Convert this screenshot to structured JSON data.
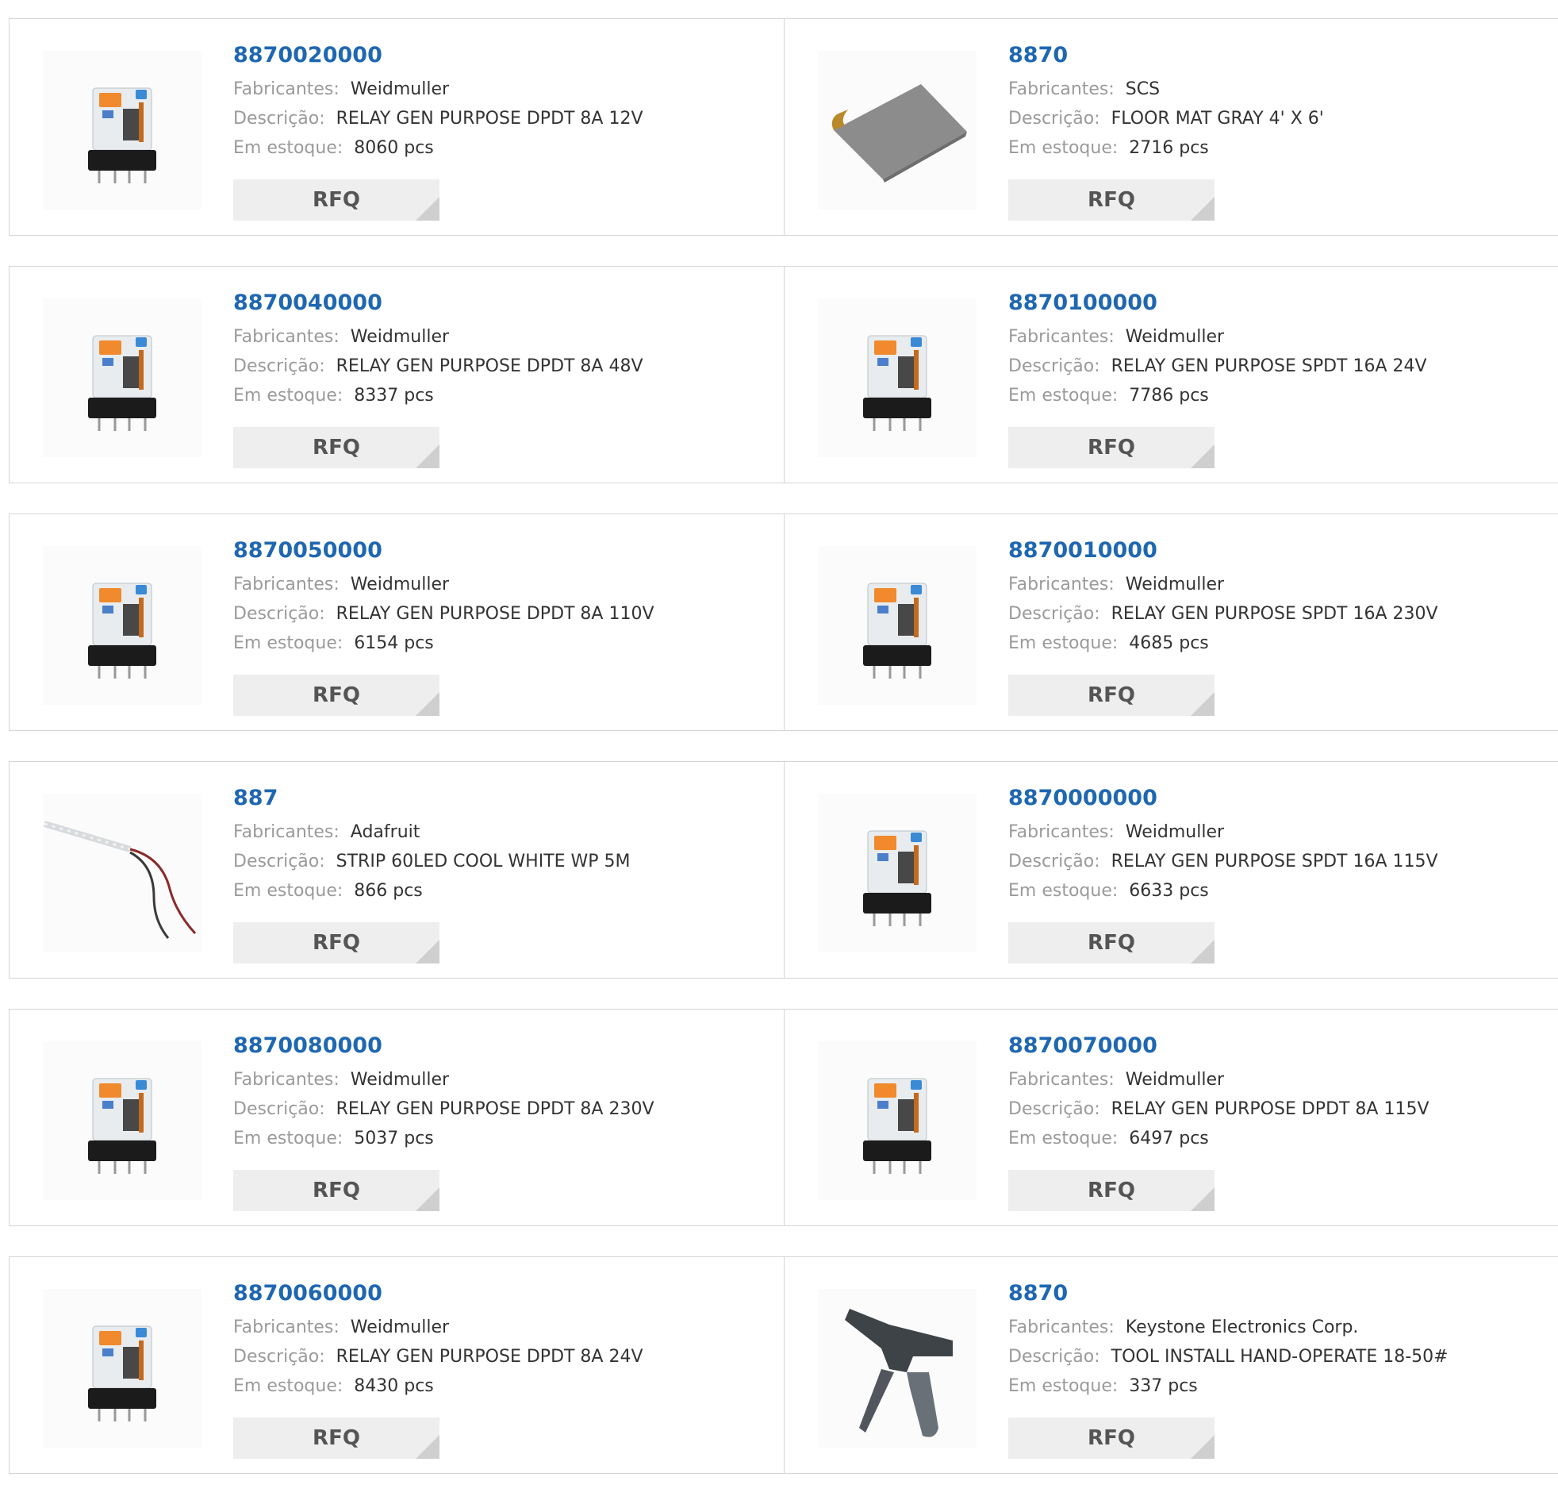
{
  "labels": {
    "manufacturer": "Fabricantes:",
    "description": "Descrição:",
    "stock": "Em estoque:",
    "rfq": "RFQ"
  },
  "colors": {
    "part_link": "#1f67b1",
    "label_gray": "#9a9a9a",
    "value_dark": "#333333",
    "button_bg": "#eeeeee"
  },
  "products": [
    {
      "part": "8870020000",
      "manufacturer": "Weidmuller",
      "description": "RELAY GEN PURPOSE DPDT 8A 12V",
      "stock": "8060 pcs",
      "image": "relay-icon"
    },
    {
      "part": "8870",
      "manufacturer": "SCS",
      "description": "FLOOR MAT GRAY 4' X 6'",
      "stock": "2716 pcs",
      "image": "floor-mat-icon"
    },
    {
      "part": "8870040000",
      "manufacturer": "Weidmuller",
      "description": "RELAY GEN PURPOSE DPDT 8A 48V",
      "stock": "8337 pcs",
      "image": "relay-icon"
    },
    {
      "part": "8870100000",
      "manufacturer": "Weidmuller",
      "description": "RELAY GEN PURPOSE SPDT 16A 24V",
      "stock": "7786 pcs",
      "image": "relay-icon"
    },
    {
      "part": "8870050000",
      "manufacturer": "Weidmuller",
      "description": "RELAY GEN PURPOSE DPDT 8A 110V",
      "stock": "6154 pcs",
      "image": "relay-icon"
    },
    {
      "part": "8870010000",
      "manufacturer": "Weidmuller",
      "description": "RELAY GEN PURPOSE SPDT 16A 230V",
      "stock": "4685 pcs",
      "image": "relay-icon"
    },
    {
      "part": "887",
      "manufacturer": "Adafruit",
      "description": "STRIP 60LED COOL WHITE WP 5M",
      "stock": "866 pcs",
      "image": "led-strip-icon"
    },
    {
      "part": "8870000000",
      "manufacturer": "Weidmuller",
      "description": "RELAY GEN PURPOSE SPDT 16A 115V",
      "stock": "6633 pcs",
      "image": "relay-icon"
    },
    {
      "part": "8870080000",
      "manufacturer": "Weidmuller",
      "description": "RELAY GEN PURPOSE DPDT 8A 230V",
      "stock": "5037 pcs",
      "image": "relay-icon"
    },
    {
      "part": "8870070000",
      "manufacturer": "Weidmuller",
      "description": "RELAY GEN PURPOSE DPDT 8A 115V",
      "stock": "6497 pcs",
      "image": "relay-icon"
    },
    {
      "part": "8870060000",
      "manufacturer": "Weidmuller",
      "description": "RELAY GEN PURPOSE DPDT 8A 24V",
      "stock": "8430 pcs",
      "image": "relay-icon"
    },
    {
      "part": "8870",
      "manufacturer": "Keystone Electronics Corp.",
      "description": "TOOL INSTALL HAND-OPERATE 18-50#",
      "stock": "337 pcs",
      "image": "hand-tool-icon"
    }
  ]
}
